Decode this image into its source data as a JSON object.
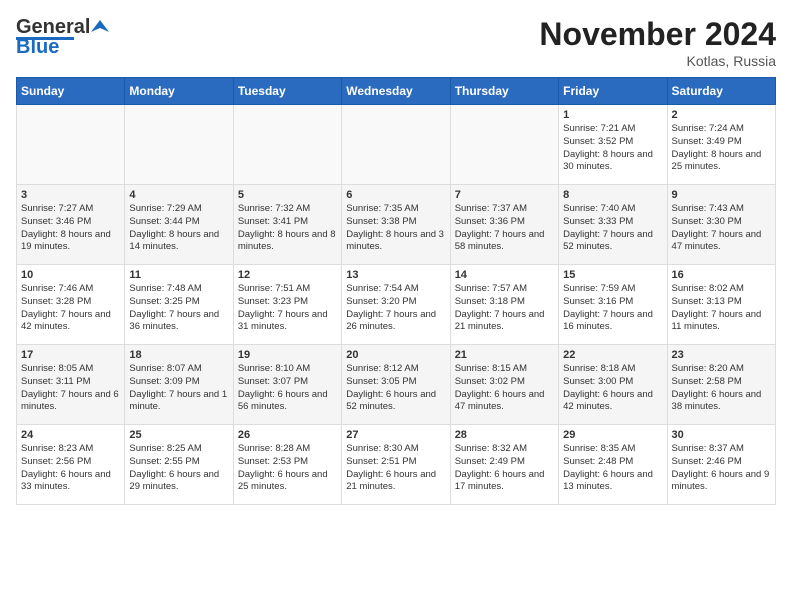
{
  "header": {
    "logo_general": "General",
    "logo_blue": "Blue",
    "title": "November 2024",
    "location": "Kotlas, Russia"
  },
  "days_of_week": [
    "Sunday",
    "Monday",
    "Tuesday",
    "Wednesday",
    "Thursday",
    "Friday",
    "Saturday"
  ],
  "weeks": [
    [
      {
        "day": "",
        "content": ""
      },
      {
        "day": "",
        "content": ""
      },
      {
        "day": "",
        "content": ""
      },
      {
        "day": "",
        "content": ""
      },
      {
        "day": "",
        "content": ""
      },
      {
        "day": "1",
        "content": "Sunrise: 7:21 AM\nSunset: 3:52 PM\nDaylight: 8 hours and 30 minutes."
      },
      {
        "day": "2",
        "content": "Sunrise: 7:24 AM\nSunset: 3:49 PM\nDaylight: 8 hours and 25 minutes."
      }
    ],
    [
      {
        "day": "3",
        "content": "Sunrise: 7:27 AM\nSunset: 3:46 PM\nDaylight: 8 hours and 19 minutes."
      },
      {
        "day": "4",
        "content": "Sunrise: 7:29 AM\nSunset: 3:44 PM\nDaylight: 8 hours and 14 minutes."
      },
      {
        "day": "5",
        "content": "Sunrise: 7:32 AM\nSunset: 3:41 PM\nDaylight: 8 hours and 8 minutes."
      },
      {
        "day": "6",
        "content": "Sunrise: 7:35 AM\nSunset: 3:38 PM\nDaylight: 8 hours and 3 minutes."
      },
      {
        "day": "7",
        "content": "Sunrise: 7:37 AM\nSunset: 3:36 PM\nDaylight: 7 hours and 58 minutes."
      },
      {
        "day": "8",
        "content": "Sunrise: 7:40 AM\nSunset: 3:33 PM\nDaylight: 7 hours and 52 minutes."
      },
      {
        "day": "9",
        "content": "Sunrise: 7:43 AM\nSunset: 3:30 PM\nDaylight: 7 hours and 47 minutes."
      }
    ],
    [
      {
        "day": "10",
        "content": "Sunrise: 7:46 AM\nSunset: 3:28 PM\nDaylight: 7 hours and 42 minutes."
      },
      {
        "day": "11",
        "content": "Sunrise: 7:48 AM\nSunset: 3:25 PM\nDaylight: 7 hours and 36 minutes."
      },
      {
        "day": "12",
        "content": "Sunrise: 7:51 AM\nSunset: 3:23 PM\nDaylight: 7 hours and 31 minutes."
      },
      {
        "day": "13",
        "content": "Sunrise: 7:54 AM\nSunset: 3:20 PM\nDaylight: 7 hours and 26 minutes."
      },
      {
        "day": "14",
        "content": "Sunrise: 7:57 AM\nSunset: 3:18 PM\nDaylight: 7 hours and 21 minutes."
      },
      {
        "day": "15",
        "content": "Sunrise: 7:59 AM\nSunset: 3:16 PM\nDaylight: 7 hours and 16 minutes."
      },
      {
        "day": "16",
        "content": "Sunrise: 8:02 AM\nSunset: 3:13 PM\nDaylight: 7 hours and 11 minutes."
      }
    ],
    [
      {
        "day": "17",
        "content": "Sunrise: 8:05 AM\nSunset: 3:11 PM\nDaylight: 7 hours and 6 minutes."
      },
      {
        "day": "18",
        "content": "Sunrise: 8:07 AM\nSunset: 3:09 PM\nDaylight: 7 hours and 1 minute."
      },
      {
        "day": "19",
        "content": "Sunrise: 8:10 AM\nSunset: 3:07 PM\nDaylight: 6 hours and 56 minutes."
      },
      {
        "day": "20",
        "content": "Sunrise: 8:12 AM\nSunset: 3:05 PM\nDaylight: 6 hours and 52 minutes."
      },
      {
        "day": "21",
        "content": "Sunrise: 8:15 AM\nSunset: 3:02 PM\nDaylight: 6 hours and 47 minutes."
      },
      {
        "day": "22",
        "content": "Sunrise: 8:18 AM\nSunset: 3:00 PM\nDaylight: 6 hours and 42 minutes."
      },
      {
        "day": "23",
        "content": "Sunrise: 8:20 AM\nSunset: 2:58 PM\nDaylight: 6 hours and 38 minutes."
      }
    ],
    [
      {
        "day": "24",
        "content": "Sunrise: 8:23 AM\nSunset: 2:56 PM\nDaylight: 6 hours and 33 minutes."
      },
      {
        "day": "25",
        "content": "Sunrise: 8:25 AM\nSunset: 2:55 PM\nDaylight: 6 hours and 29 minutes."
      },
      {
        "day": "26",
        "content": "Sunrise: 8:28 AM\nSunset: 2:53 PM\nDaylight: 6 hours and 25 minutes."
      },
      {
        "day": "27",
        "content": "Sunrise: 8:30 AM\nSunset: 2:51 PM\nDaylight: 6 hours and 21 minutes."
      },
      {
        "day": "28",
        "content": "Sunrise: 8:32 AM\nSunset: 2:49 PM\nDaylight: 6 hours and 17 minutes."
      },
      {
        "day": "29",
        "content": "Sunrise: 8:35 AM\nSunset: 2:48 PM\nDaylight: 6 hours and 13 minutes."
      },
      {
        "day": "30",
        "content": "Sunrise: 8:37 AM\nSunset: 2:46 PM\nDaylight: 6 hours and 9 minutes."
      }
    ]
  ]
}
